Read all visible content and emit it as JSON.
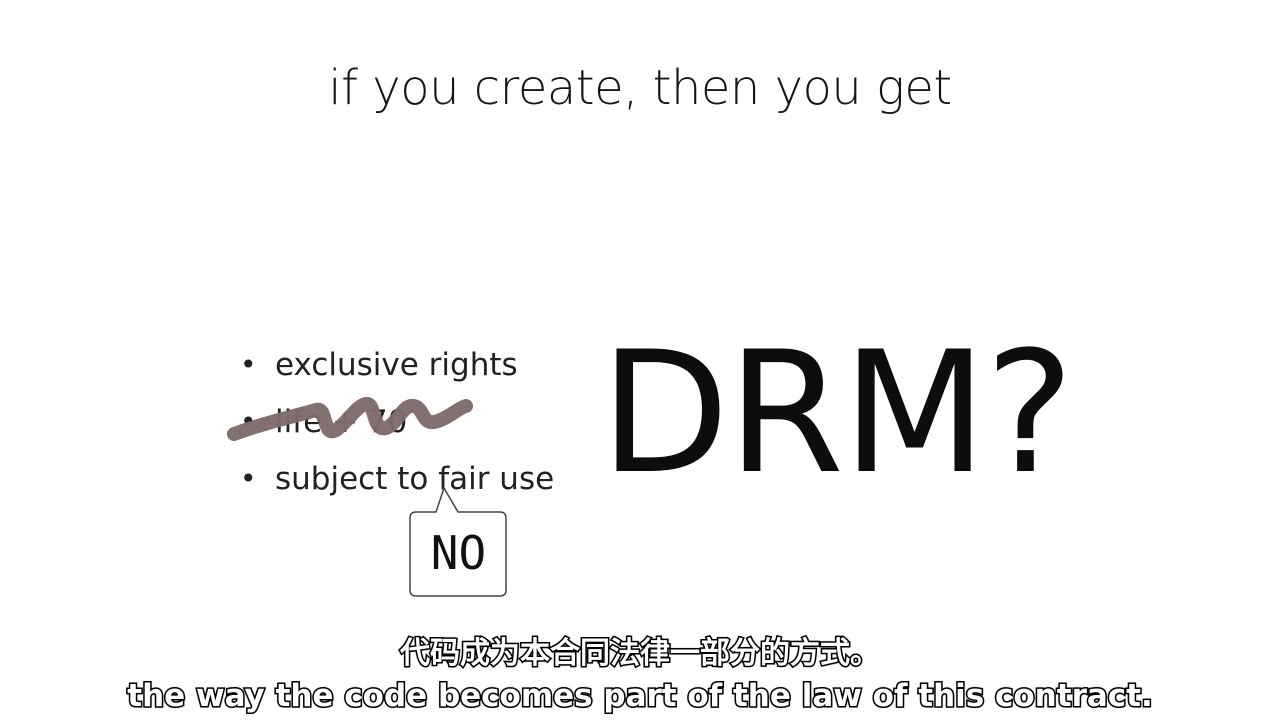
{
  "slide": {
    "title": "if you create, then you get",
    "bullets": [
      {
        "text": "exclusive rights",
        "struck": false
      },
      {
        "text": "life + 70",
        "struck": true
      },
      {
        "text": "subject to fair use",
        "struck": false
      }
    ],
    "callout_text": "NO",
    "headline": "DRM?"
  },
  "subtitles": {
    "chinese": "代码成为本合同法律一部分的方式。",
    "english": "the way the code becomes part of the law of this contract."
  },
  "colors": {
    "background": "#ffffff",
    "text": "#111111",
    "scribble": "#7e6a6a"
  }
}
